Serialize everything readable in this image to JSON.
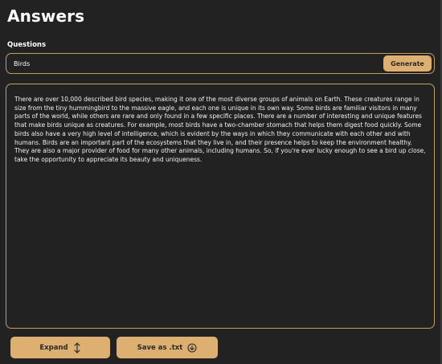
{
  "header": {
    "title": "Answers"
  },
  "question": {
    "label": "Questions",
    "value": "Birds",
    "generate_label": "Generate"
  },
  "answer": {
    "text": "There are over 10,000 described bird species, making it one of the most diverse groups of animals on Earth. These creatures range in size from the tiny hummingbird to the massive eagle, and each one is unique in its own way. Some birds are familiar visitors in many parts of the world, while others are rare and only found in a few specific places. There are a number of interesting and unique features that make birds unique as creatures. For example, most birds have a two-chamber stomach that helps them digest food quickly. Some birds also have a very high level of intelligence, which is evident by the ways in which they communicate with each other and with humans. Birds are an important part of the ecosystems that they live in, and their presence helps to keep the environment healthy. They are also a major provider of food for many other animals, including humans. So, if you're ever lucky enough to see a bird up close, take the opportunity to appreciate its beauty and uniqueness."
  },
  "actions": {
    "expand_label": "Expand",
    "expand_icon": "expand-vertical-icon",
    "save_label": "Save as .txt",
    "save_icon": "download-circle-icon"
  },
  "colors": {
    "background": "#222222",
    "accent": "#ddaf71",
    "border": "#c49d63",
    "text": "#ffffff",
    "button_text": "#2a2a2a"
  }
}
